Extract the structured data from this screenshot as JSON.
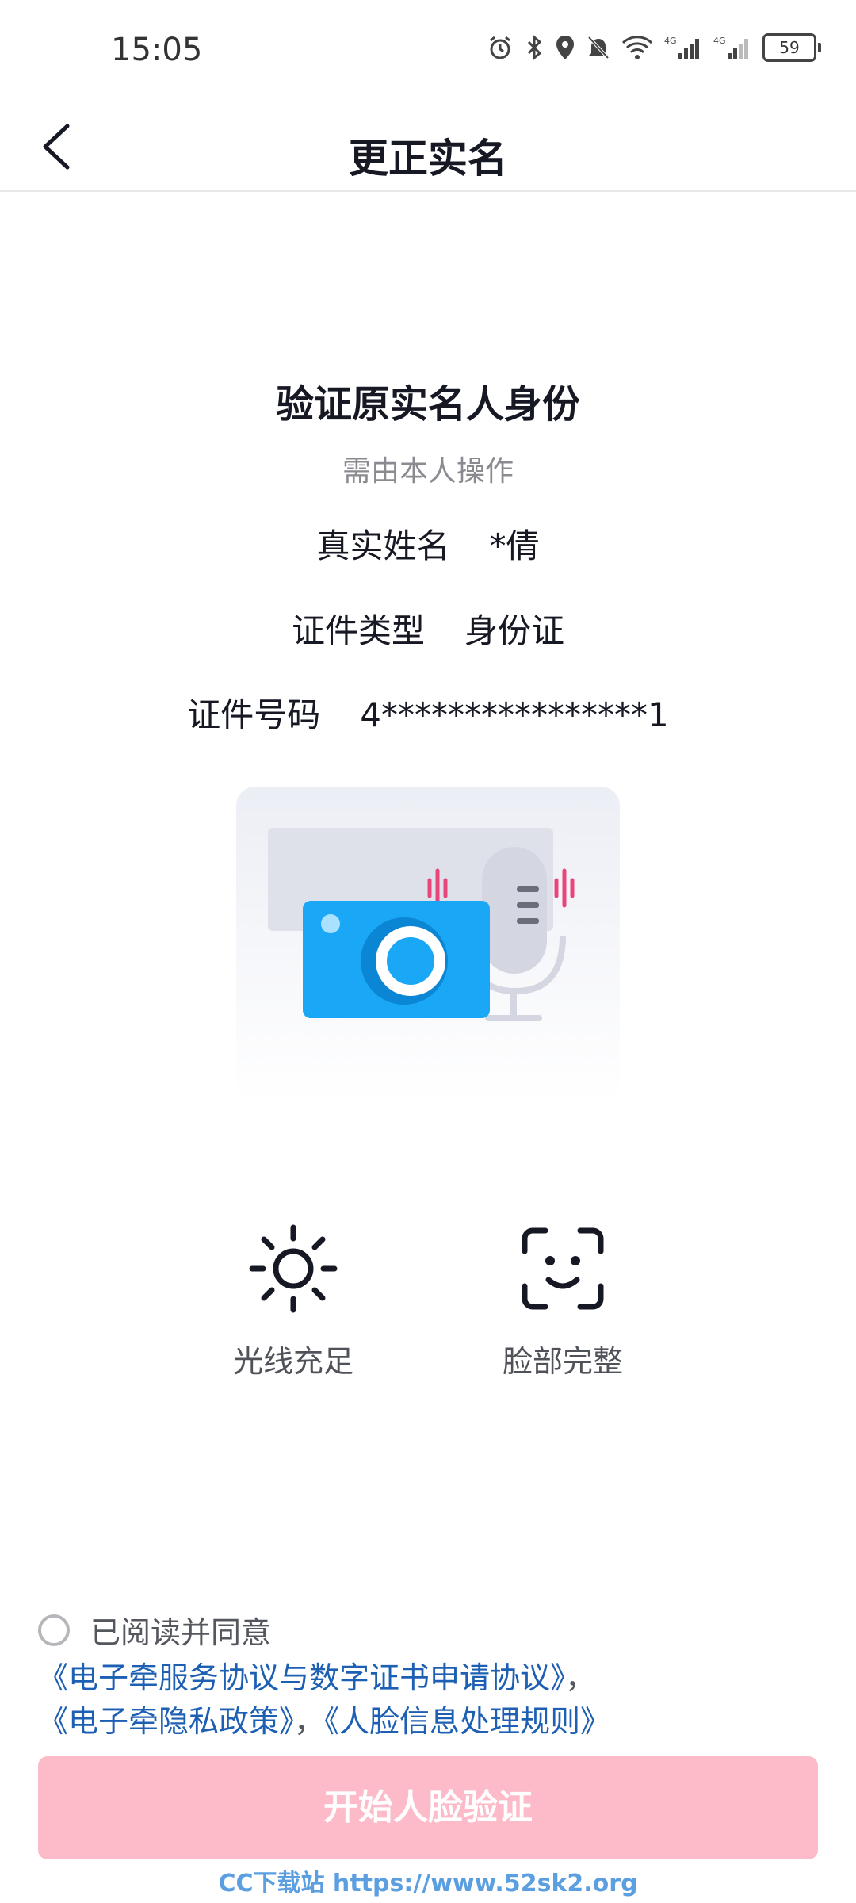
{
  "status_bar": {
    "time": "15:05",
    "battery": "59"
  },
  "header": {
    "title": "更正实名"
  },
  "verify": {
    "title": "验证原实名人身份",
    "subtitle": "需由本人操作",
    "name_label": "真实姓名",
    "name_value": "*倩",
    "idtype_label": "证件类型",
    "idtype_value": "身份证",
    "idnum_label": "证件号码",
    "idnum_value": "4****************1"
  },
  "tips": [
    {
      "label": "光线充足",
      "icon": "sun-icon"
    },
    {
      "label": "脸部完整",
      "icon": "face-scan-icon"
    }
  ],
  "agreement": {
    "prefix": "已阅读并同意",
    "link1": "《电子牵服务协议与数字证书申请协议》",
    "sep1": "，",
    "link2": "《电子牵隐私政策》",
    "sep2": "，",
    "link3": "《人脸信息处理规则》"
  },
  "button": {
    "label": "开始人脸验证"
  },
  "watermark": "CC下载站 https://www.52sk2.org",
  "colors": {
    "accent_link": "#1d5fb3",
    "button_bg": "#fdbac8",
    "illustration_blue": "#1aa7f5"
  }
}
